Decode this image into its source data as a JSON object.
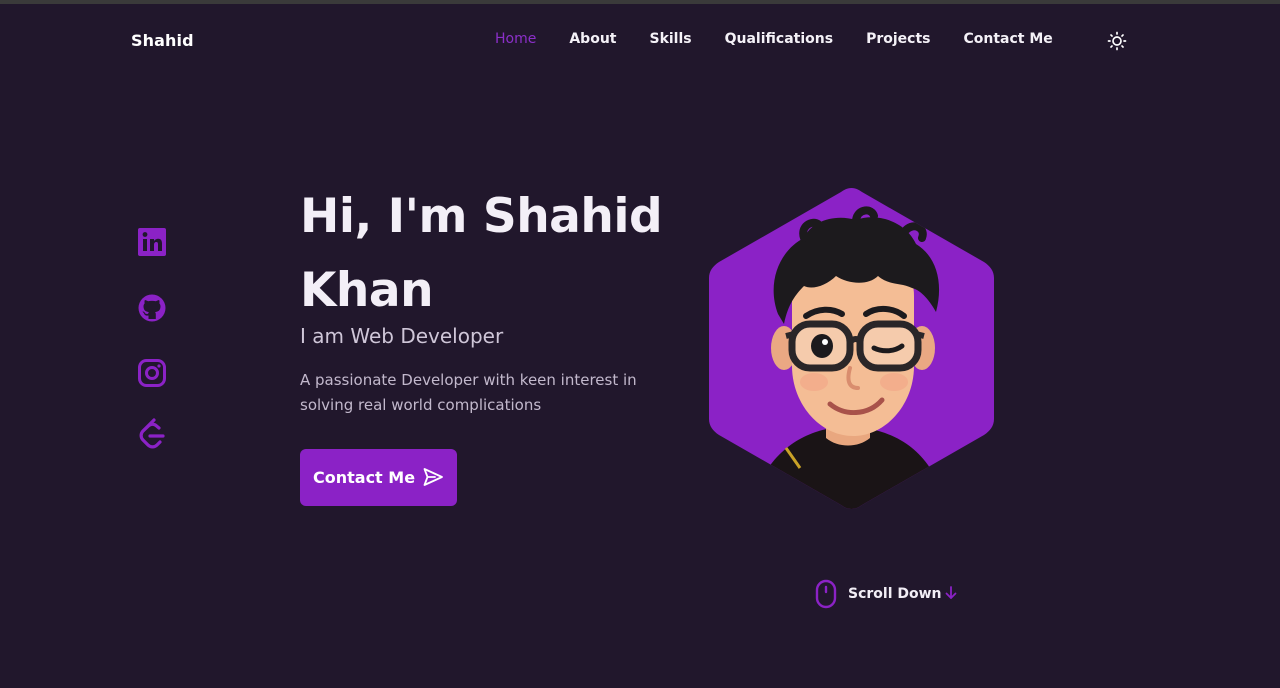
{
  "nav": {
    "brand": "Shahid",
    "links": [
      {
        "label": "Home",
        "active": true
      },
      {
        "label": "About",
        "active": false
      },
      {
        "label": "Skills",
        "active": false
      },
      {
        "label": "Qualifications",
        "active": false
      },
      {
        "label": "Projects",
        "active": false
      },
      {
        "label": "Contact Me",
        "active": false
      }
    ],
    "theme_icon": "sun-icon"
  },
  "social": [
    {
      "icon": "linkedin-icon"
    },
    {
      "icon": "github-icon"
    },
    {
      "icon": "instagram-icon"
    },
    {
      "icon": "leetcode-icon"
    }
  ],
  "hero": {
    "title_line1": "Hi, I'm Shahid",
    "title_line2": "Khan",
    "subtitle": "I am Web Developer",
    "description": "A passionate Developer with keen interest in solving real world complications",
    "cta_label": "Contact Me",
    "cta_icon": "send-icon"
  },
  "avatar": {
    "icon": "avatar-illustration"
  },
  "scroll": {
    "label": "Scroll Down",
    "mouse_icon": "mouse-icon",
    "arrow_icon": "arrow-down-icon"
  },
  "colors": {
    "background": "#21172c",
    "accent": "#8b22c6",
    "text": "#f2eef6",
    "muted_text": "#c2b8cc"
  }
}
